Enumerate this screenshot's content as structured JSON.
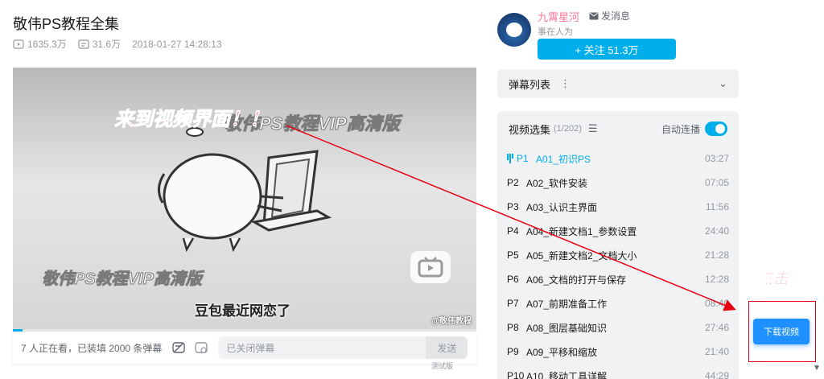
{
  "video": {
    "title": "敬伟PS教程全集",
    "views": "1635.3万",
    "danmaku_count": "31.6万",
    "date": "2018-01-27 14:28:13"
  },
  "player": {
    "headline": "来到视频界面！！",
    "watermark": "敬伟PS教程VIP高清版",
    "subtitle": "豆包最近网恋了",
    "brand": "@敬伟教程",
    "progress": 0.02
  },
  "danmaku_bar": {
    "watching": "7 人正在看，已装填 2000 条弹幕",
    "input_placeholder": "已关闭弹幕",
    "send": "发送",
    "test_tag": "测试版"
  },
  "uploader": {
    "name": "九霄星河",
    "message": "发消息",
    "desc": "事在人为",
    "follow": "+ 关注 51.3万"
  },
  "danmaku_list": {
    "label": "弹幕列表"
  },
  "playlist": {
    "title": "视频选集",
    "count": "(1/202)",
    "autoplay": "自动连播",
    "items": [
      {
        "p": "P1",
        "title": "A01_初识PS",
        "duration": "03:27",
        "active": true
      },
      {
        "p": "P2",
        "title": "A02_软件安装",
        "duration": "07:05"
      },
      {
        "p": "P3",
        "title": "A03_认识主界面",
        "duration": "11:56"
      },
      {
        "p": "P4",
        "title": "A04_新建文档1_参数设置",
        "duration": "24:40"
      },
      {
        "p": "P5",
        "title": "A05_新建文档2_文档大小",
        "duration": "21:28"
      },
      {
        "p": "P6",
        "title": "A06_文档的打开与保存",
        "duration": "12:28"
      },
      {
        "p": "P7",
        "title": "A07_前期准备工作",
        "duration": "08:40"
      },
      {
        "p": "P8",
        "title": "A08_图层基础知识",
        "duration": "27:46"
      },
      {
        "p": "P9",
        "title": "A09_平移和缩放",
        "duration": "21:40"
      },
      {
        "p": "P10",
        "title": "A10_移动工具详解",
        "duration": "44:29"
      }
    ]
  },
  "annotation": {
    "click_label": "点击",
    "download_button": "下载视频"
  },
  "colors": {
    "accent": "#00aeec",
    "uploader_name": "#fb7299",
    "annotation_red": "#e60012",
    "download_blue": "#1e90ff"
  }
}
